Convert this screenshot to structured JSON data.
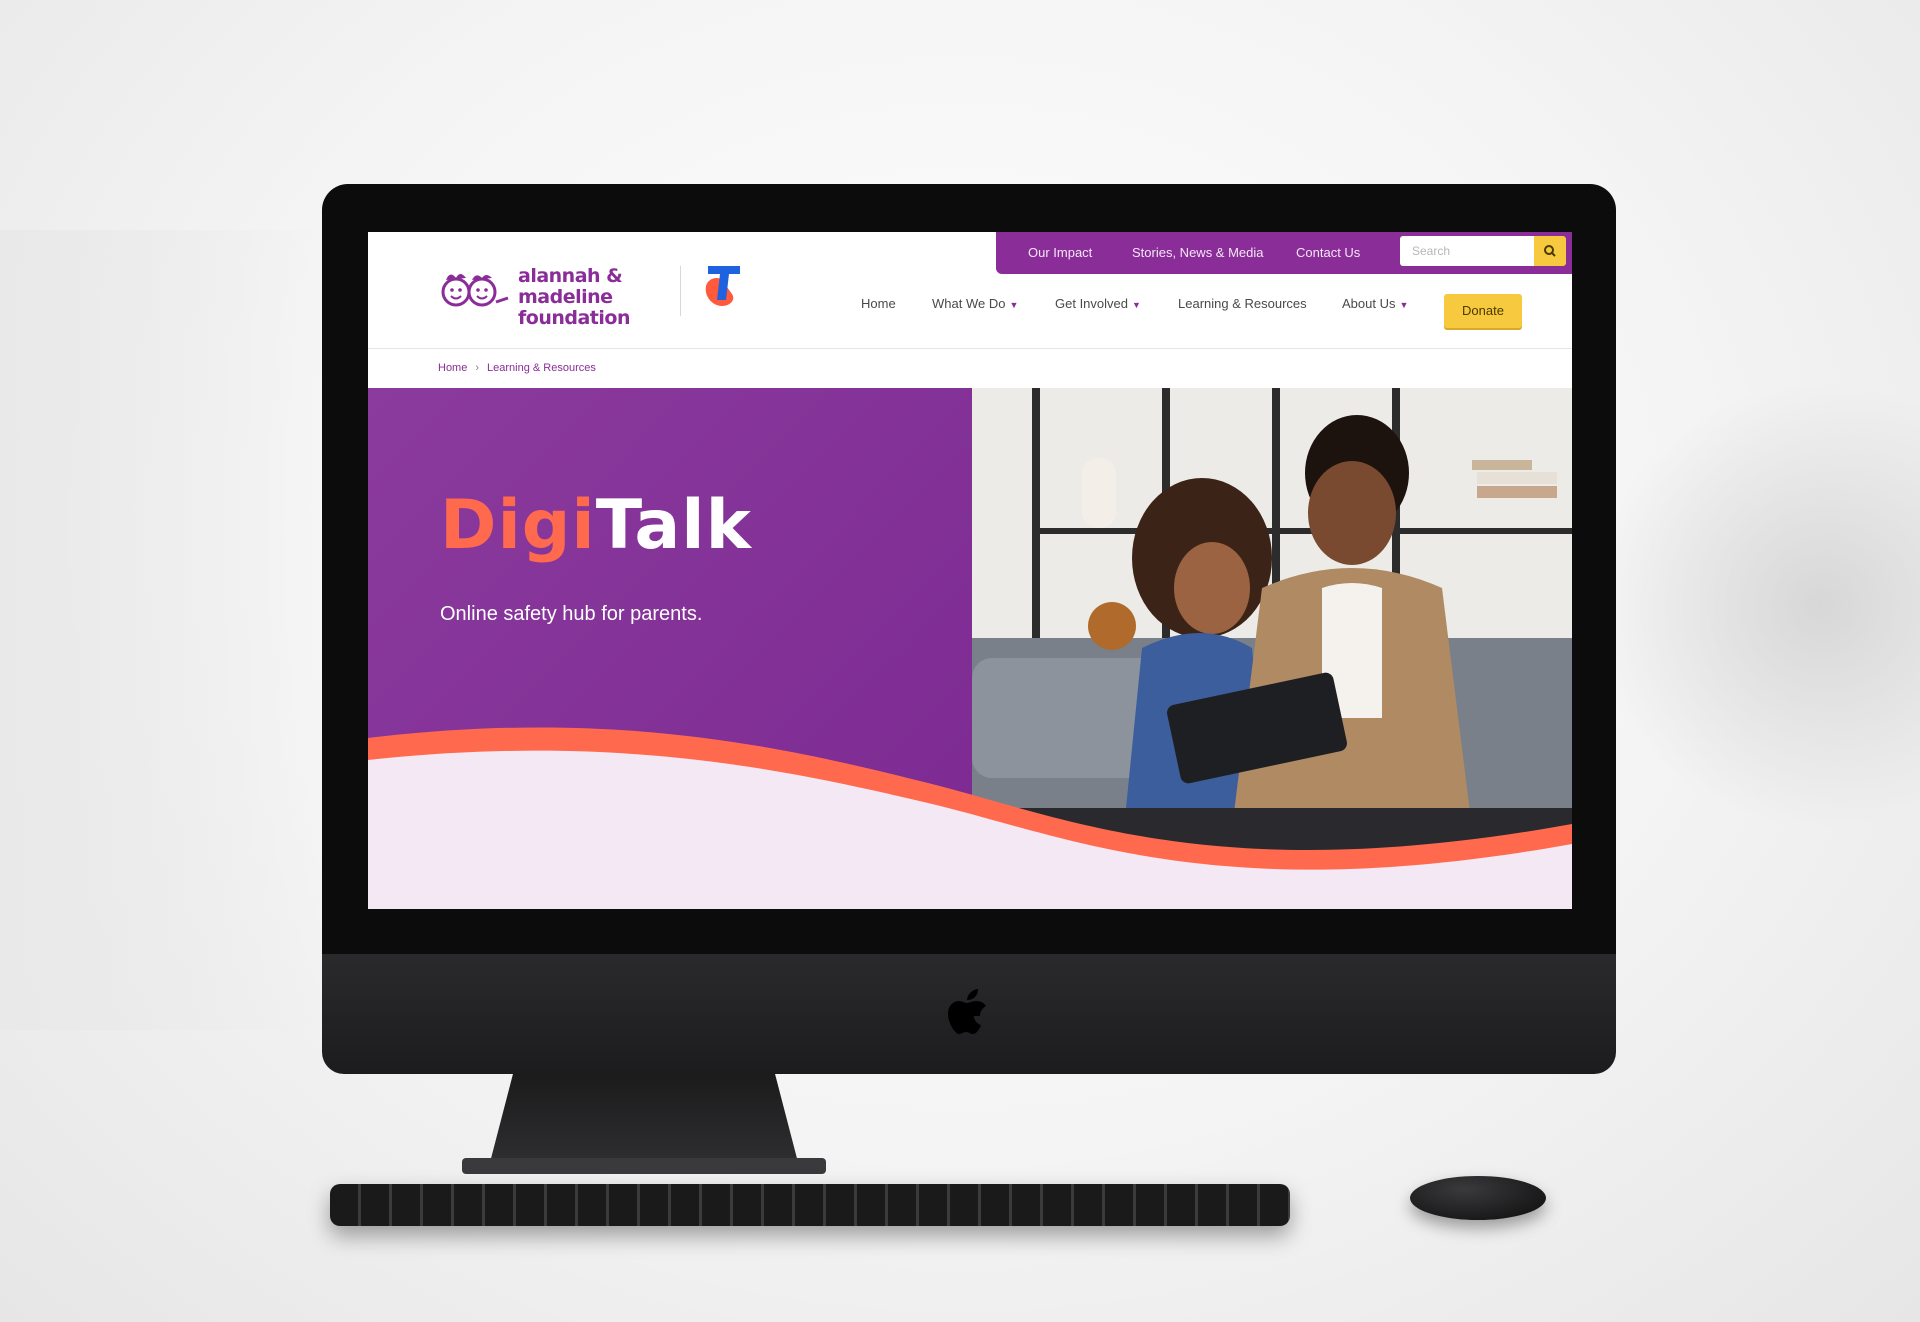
{
  "colors": {
    "brand_purple": "#8a2d98",
    "accent_orange": "#ff6a4f",
    "donate_yellow": "#f7c93e",
    "hero_bottom": "#f4e8f5"
  },
  "topbar": {
    "links": [
      "Our Impact",
      "Stories, News & Media",
      "Contact Us"
    ],
    "search_placeholder": "Search",
    "search_icon": "search-icon"
  },
  "logo": {
    "line1": "alannah & madeline",
    "line2": "foundation",
    "partner_mark": "T"
  },
  "nav": {
    "items": [
      {
        "label": "Home",
        "has_dropdown": false
      },
      {
        "label": "What We Do",
        "has_dropdown": true
      },
      {
        "label": "Get Involved",
        "has_dropdown": true
      },
      {
        "label": "Learning & Resources",
        "has_dropdown": false
      },
      {
        "label": "About Us",
        "has_dropdown": true
      }
    ],
    "donate_label": "Donate"
  },
  "breadcrumb": {
    "items": [
      "Home",
      "Learning & Resources"
    ]
  },
  "hero": {
    "title_part1": "Digi",
    "title_part2": "Talk",
    "subtitle": "Online safety hub for parents."
  }
}
